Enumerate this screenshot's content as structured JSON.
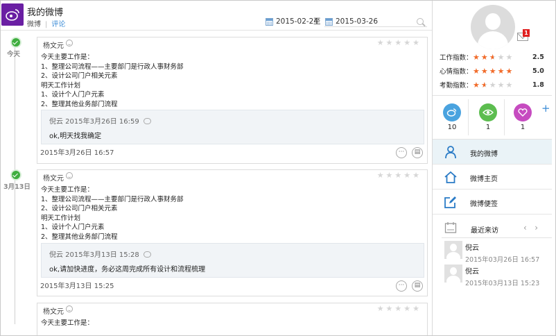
{
  "header": {
    "title": "我的微博",
    "tabs": [
      {
        "label": "微博"
      },
      {
        "label": "评论"
      }
    ],
    "date_from": "2015-02-24",
    "date_sep": "至",
    "date_to": "2015-03-26"
  },
  "timeline": {
    "labels": [
      "今天",
      "3月13日"
    ]
  },
  "posts": [
    {
      "author": "杨文元",
      "body": "今天主要工作是：\n1、整理公司流程——主要部门是行政人事财务部\n2、设计公司门户相关元素\n明天工作计划\n1、设计个人门户元素\n2、整理其他业务部门流程",
      "reply_head": "倪云 2015年3月26日 16:59",
      "reply_text": "ok,明天找我确定",
      "time": "2015年3月26日 16:57"
    },
    {
      "author": "杨文元",
      "body": "今天主要工作是：\n1、整理公司流程——主要部门是行政人事财务部\n2、设计公司门户相关元素\n明天工作计划\n1、设计个人门户元素\n2、整理其他业务部门流程",
      "reply_head": "倪云 2015年3月13日 15:28",
      "reply_text": "ok,请加快进度，务必这周完成所有设计和流程梳理",
      "time": "2015年3月13日 15:25"
    },
    {
      "author": "杨文元",
      "body": "今天主要工作是："
    }
  ],
  "profile": {
    "mail_badge": "1",
    "ratings": [
      {
        "label": "工作指数：",
        "value": "2.5",
        "level": 2.5
      },
      {
        "label": "心情指数：",
        "value": "5.0",
        "level": 5
      },
      {
        "label": "考勤指数：",
        "value": "1.8",
        "level": 1.5
      }
    ],
    "stats": [
      {
        "icon": "weibo-icon",
        "value": "10",
        "color": "#4aa3df"
      },
      {
        "icon": "eye-icon",
        "value": "1",
        "color": "#5cbd4f"
      },
      {
        "icon": "heart-icon",
        "value": "1",
        "color": "#c64bc0"
      }
    ],
    "add": "+"
  },
  "menu": [
    {
      "label": "我的微博",
      "icon": "person-icon"
    },
    {
      "label": "微博主页",
      "icon": "home-icon"
    },
    {
      "label": "微博便签",
      "icon": "edit-icon"
    }
  ],
  "recent": {
    "title": "最近来访",
    "prev": "‹",
    "next": "›",
    "visitors": [
      {
        "name": "倪云",
        "time": "2015年03月26日 16:57"
      },
      {
        "name": "倪云",
        "time": "2015年03月13日 15:23"
      }
    ]
  }
}
